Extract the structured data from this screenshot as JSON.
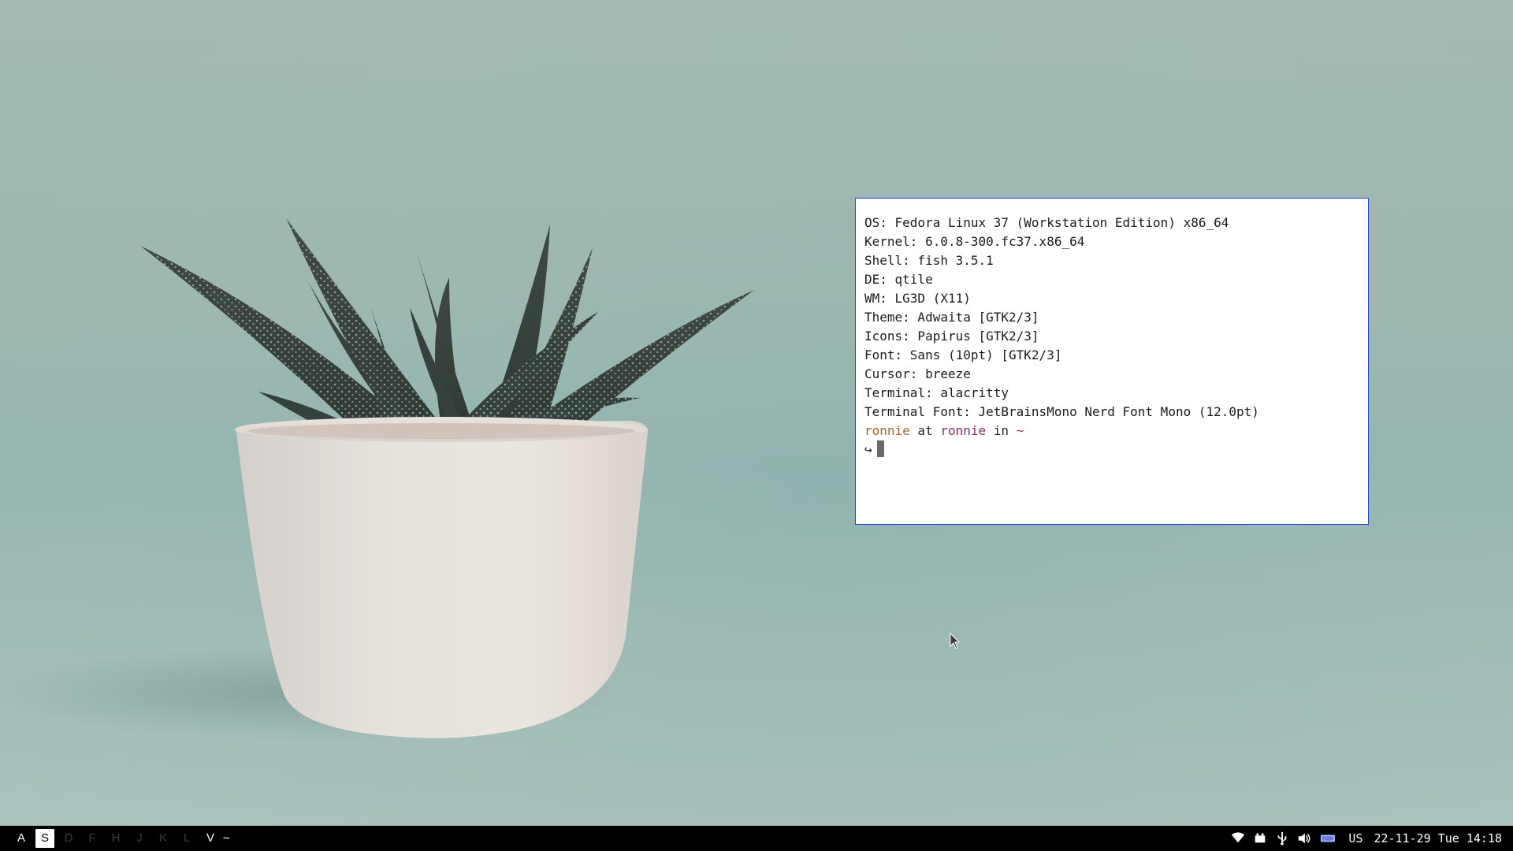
{
  "terminal": {
    "lines": [
      "OS: Fedora Linux 37 (Workstation Edition) x86_64",
      "Kernel: 6.0.8-300.fc37.x86_64",
      "Shell: fish 3.5.1",
      "DE: qtile",
      "WM: LG3D (X11)",
      "Theme: Adwaita [GTK2/3]",
      "Icons: Papirus [GTK2/3]",
      "Font: Sans (10pt) [GTK2/3]",
      "Cursor: breeze",
      "Terminal: alacritty",
      "Terminal Font: JetBrainsMono Nerd Font Mono (12.0pt)"
    ],
    "prompt": {
      "user": "ronnie",
      "at": "at",
      "host": "ronnie",
      "in": "in",
      "dir": "~",
      "arrow": "↪"
    },
    "colors": {
      "border": "#1f3fd6",
      "user": "#a4652b",
      "host": "#8a2f63"
    }
  },
  "bar": {
    "groups": [
      {
        "label": "A",
        "state": "occupied"
      },
      {
        "label": "S",
        "state": "active"
      },
      {
        "label": "D",
        "state": "empty"
      },
      {
        "label": "F",
        "state": "empty"
      },
      {
        "label": "H",
        "state": "empty"
      },
      {
        "label": "J",
        "state": "empty"
      },
      {
        "label": "K",
        "state": "empty"
      },
      {
        "label": "L",
        "state": "empty"
      },
      {
        "label": "V",
        "state": "occupied"
      }
    ],
    "layout_indicator": "~",
    "tray_icons": [
      "wifi-icon",
      "battery-icon",
      "usb-icon",
      "volume-icon",
      "keyboard-icon"
    ],
    "keyboard_layout": "US",
    "clock": "22-11-29 Tue 14:18"
  }
}
